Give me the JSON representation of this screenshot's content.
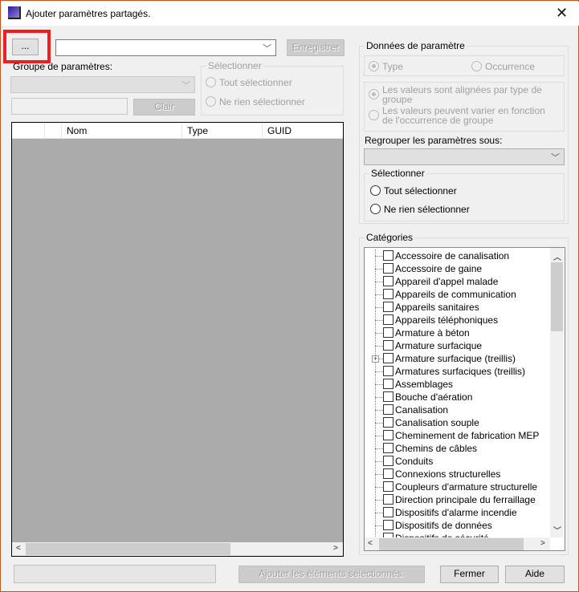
{
  "window": {
    "title": "Ajouter paramètres partagés.",
    "close_icon": "close-icon",
    "accent_border": "#c4561d",
    "highlight_color": "#ee1c25"
  },
  "top": {
    "browse_label": "...",
    "file_combo_value": "",
    "save_label": "Enregistrer"
  },
  "left": {
    "group_label": "Groupe de paramètres:",
    "filter_value": "",
    "clear_label": "Clair",
    "select_group": {
      "title": "Sélectionner",
      "all": "Tout sélectionner",
      "none": "Ne rien sélectionner"
    },
    "table": {
      "columns": [
        "",
        "",
        "Nom",
        "Type",
        "GUID"
      ],
      "rows": []
    }
  },
  "right": {
    "param_data": {
      "title": "Données de paramètre",
      "type": "Type",
      "occurrence": "Occurrence",
      "aligned_1": "Les valeurs sont alignées par type de",
      "aligned_2": "groupe",
      "vary_1": "Les valeurs peuvent varier en fonction",
      "vary_2": "de l'occurrence de groupe",
      "regroup_label": "Regrouper les paramètres sous:",
      "select_title": "Sélectionner",
      "select_all": "Tout sélectionner",
      "select_none": "Ne rien sélectionner"
    },
    "categories": {
      "title": "Catégories",
      "items": [
        "Accessoire de canalisation",
        "Accessoire de gaine",
        "Appareil d'appel malade",
        "Appareils de communication",
        "Appareils sanitaires",
        "Appareils téléphoniques",
        "Armature à béton",
        "Armature surfacique",
        "Armature surfacique (treillis)",
        "Armatures surfaciques (treillis)",
        "Assemblages",
        "Bouche d'aération",
        "Canalisation",
        "Canalisation souple",
        "Cheminement de fabrication MEP",
        "Chemins de câbles",
        "Conduits",
        "Connexions structurelles",
        "Coupleurs d'armature structurelle",
        "Direction principale du ferraillage",
        "Dispositifs d'alarme incendie",
        "Dispositifs de données",
        "Dispositifs de sécurité"
      ],
      "expandable_index": 8
    }
  },
  "bottom": {
    "status_value": "",
    "add_label": "Ajouter les éléments sélectionnés.",
    "close_label": "Fermer",
    "help_label": "Aide"
  }
}
